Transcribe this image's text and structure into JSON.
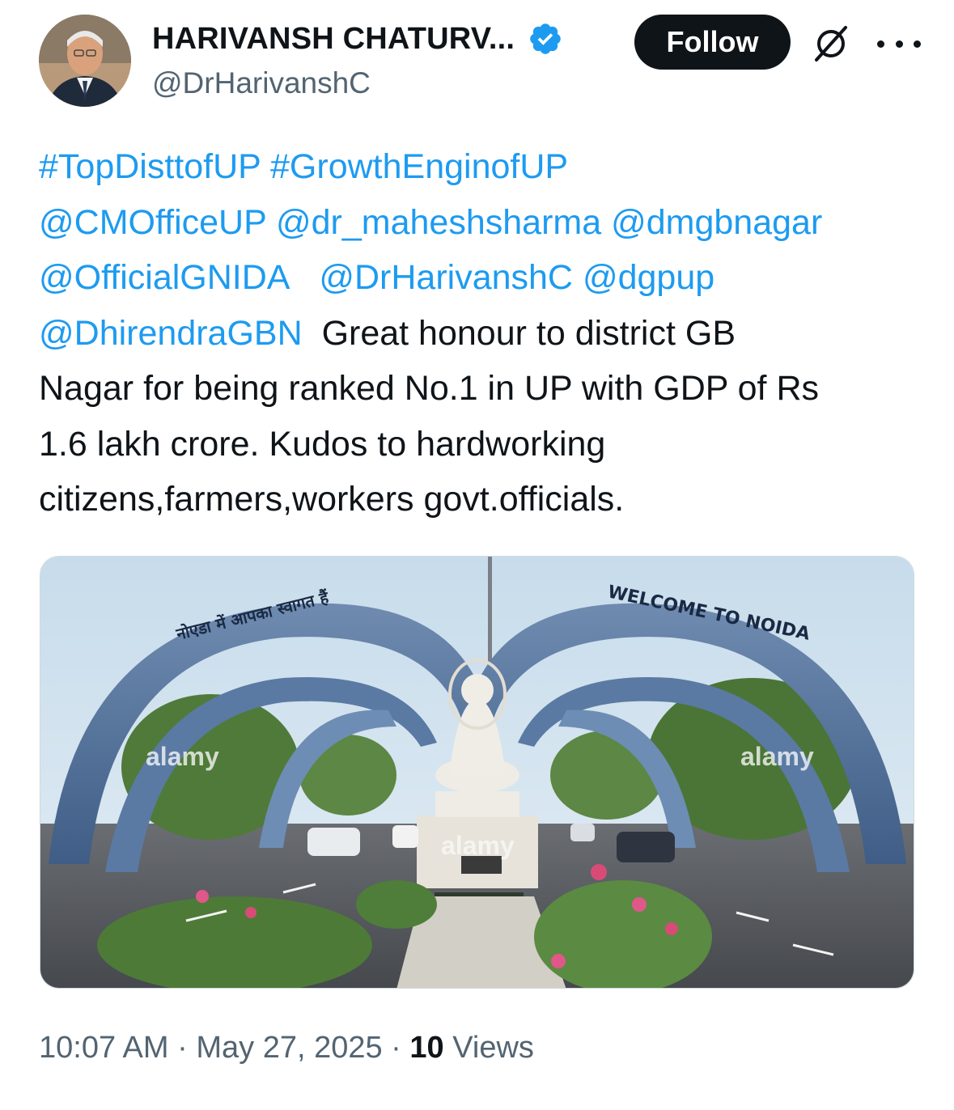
{
  "author": {
    "display_name": "HARIVANSH CHATURV...",
    "handle": "@DrHarivanshC",
    "verified_icon": "verified-badge-icon"
  },
  "actions": {
    "follow_label": "Follow",
    "grok_icon": "grok-icon",
    "more_icon": "more-options-icon"
  },
  "tweet": {
    "hashtags": [
      "#TopDisttofUP",
      "#GrowthEnginofUP"
    ],
    "mentions_line1": [
      "@CMOfficeUP",
      "@dr_maheshsharma",
      "@dmgbnagar"
    ],
    "mentions_line2": [
      "@OfficialGNIDA",
      "@DrHarivanshC",
      "@dgpup"
    ],
    "mention_line3": "@DhirendraGBN",
    "text_line3": "Great honour to district GB",
    "text_line4": "Nagar for being ranked No.1 in UP with GDP of Rs",
    "text_line5": "1.6 lakh crore. Kudos to hardworking",
    "text_line6": "citizens,farmers,workers govt.officials."
  },
  "media": {
    "arch_text_english": "WELCOME TO NOIDA",
    "arch_text_hindi": "नोएडा में आपका स्वागत हैं",
    "watermark": "alamy"
  },
  "meta": {
    "time": "10:07 AM",
    "separator": "·",
    "date": "May 27, 2025",
    "views_count": "10",
    "views_label": "Views"
  },
  "colors": {
    "link": "#1d9bf0",
    "text": "#0f1419",
    "secondary": "#536471",
    "follow_bg": "#0f1419"
  }
}
